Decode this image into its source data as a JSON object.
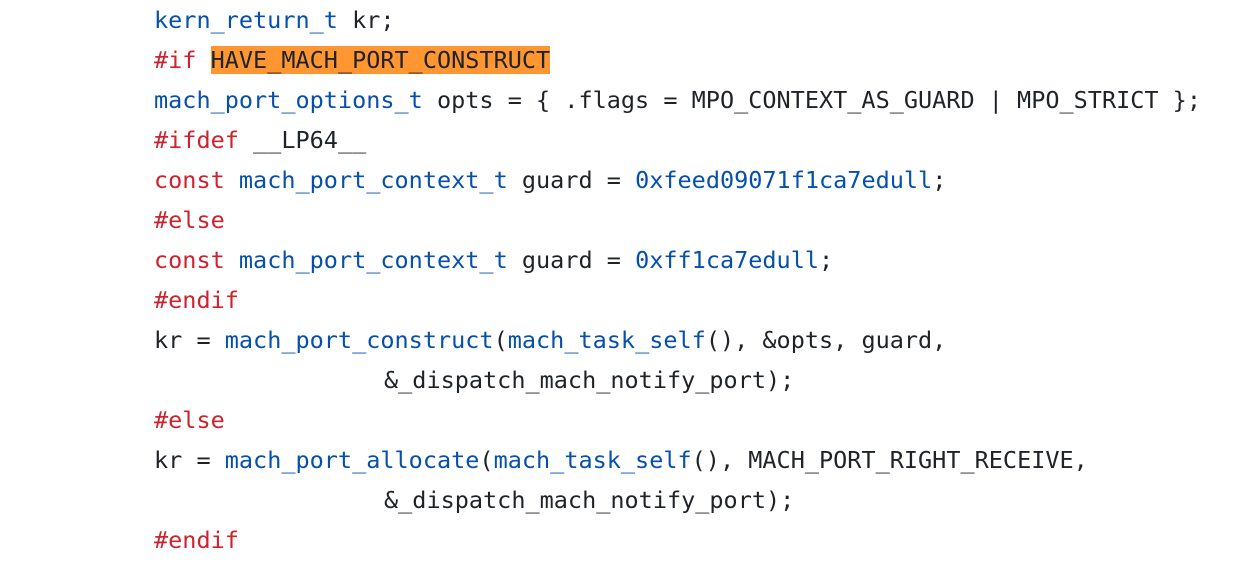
{
  "colors": {
    "preprocessor": "#cf222e",
    "keyword": "#cf222e",
    "type": "#0550ae",
    "function": "#0550ae",
    "number": "#0550ae",
    "plain": "#1f2328",
    "search_highlight": "#ff9632",
    "background": "#ffffff"
  },
  "lines": [
    {
      "indent": 1,
      "tokens": [
        {
          "t": "kern_return_t",
          "k": "ty"
        },
        {
          "t": " kr;",
          "k": "plain"
        }
      ]
    },
    {
      "indent": 0,
      "tokens": [
        {
          "t": "#if",
          "k": "pp"
        },
        {
          "t": " ",
          "k": "plain"
        },
        {
          "t": "HAVE_MACH_PORT_CONSTRUCT",
          "k": "hl"
        }
      ]
    },
    {
      "indent": 1,
      "tokens": [
        {
          "t": "mach_port_options_t",
          "k": "ty"
        },
        {
          "t": " opts = { .flags = MPO_CONTEXT_AS_GUARD | MPO_STRICT };",
          "k": "plain"
        }
      ]
    },
    {
      "indent": 0,
      "tokens": [
        {
          "t": "#ifdef",
          "k": "pp"
        },
        {
          "t": " __LP64__",
          "k": "plain"
        }
      ]
    },
    {
      "indent": 1,
      "tokens": [
        {
          "t": "const",
          "k": "kw"
        },
        {
          "t": " ",
          "k": "plain"
        },
        {
          "t": "mach_port_context_t",
          "k": "ty"
        },
        {
          "t": " guard = ",
          "k": "plain"
        },
        {
          "t": "0xfeed09071f1ca7edull",
          "k": "num"
        },
        {
          "t": ";",
          "k": "plain"
        }
      ]
    },
    {
      "indent": 0,
      "tokens": [
        {
          "t": "#else",
          "k": "pp"
        }
      ]
    },
    {
      "indent": 1,
      "tokens": [
        {
          "t": "const",
          "k": "kw"
        },
        {
          "t": " ",
          "k": "plain"
        },
        {
          "t": "mach_port_context_t",
          "k": "ty"
        },
        {
          "t": " guard = ",
          "k": "plain"
        },
        {
          "t": "0xff1ca7edull",
          "k": "num"
        },
        {
          "t": ";",
          "k": "plain"
        }
      ]
    },
    {
      "indent": 0,
      "tokens": [
        {
          "t": "#endif",
          "k": "pp"
        }
      ]
    },
    {
      "indent": 1,
      "tokens": [
        {
          "t": "kr = ",
          "k": "plain"
        },
        {
          "t": "mach_port_construct",
          "k": "fn"
        },
        {
          "t": "(",
          "k": "plain"
        },
        {
          "t": "mach_task_self",
          "k": "fn"
        },
        {
          "t": "(), &opts, guard,",
          "k": "plain"
        }
      ]
    },
    {
      "indent": 2,
      "tokens": [
        {
          "t": "&_dispatch_mach_notify_port);",
          "k": "plain"
        }
      ]
    },
    {
      "indent": 0,
      "tokens": [
        {
          "t": "#else",
          "k": "pp"
        }
      ]
    },
    {
      "indent": 1,
      "tokens": [
        {
          "t": "kr = ",
          "k": "plain"
        },
        {
          "t": "mach_port_allocate",
          "k": "fn"
        },
        {
          "t": "(",
          "k": "plain"
        },
        {
          "t": "mach_task_self",
          "k": "fn"
        },
        {
          "t": "(), MACH_PORT_RIGHT_RECEIVE,",
          "k": "plain"
        }
      ]
    },
    {
      "indent": 2,
      "tokens": [
        {
          "t": "&_dispatch_mach_notify_port);",
          "k": "plain"
        }
      ]
    },
    {
      "indent": 0,
      "tokens": [
        {
          "t": "#endif",
          "k": "pp"
        }
      ]
    }
  ]
}
